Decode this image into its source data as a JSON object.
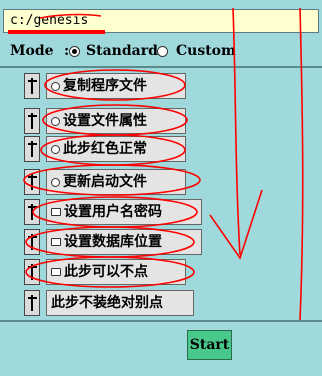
{
  "path": {
    "value": "c:/genesis"
  },
  "mode": {
    "label": "Mode",
    "colon": ":",
    "options": [
      {
        "label": "Standard",
        "selected": true
      },
      {
        "label": "Custom",
        "selected": false
      }
    ]
  },
  "tasks": [
    {
      "label": "复制程序文件",
      "status_icon": "circle-icon"
    },
    {
      "label": "设置文件属性",
      "status_icon": "circle-icon"
    },
    {
      "label": "此步红色正常",
      "status_icon": "circle-icon"
    },
    {
      "label": "更新启动文件",
      "status_icon": "circle-icon"
    },
    {
      "label": "设置用户名密码",
      "status_icon": "lock-icon"
    },
    {
      "label": "设置数据库位置",
      "status_icon": "lock-icon"
    },
    {
      "label": "此步可以不点",
      "status_icon": "lock-icon"
    },
    {
      "label": "此步不装绝对别点",
      "status_icon": ""
    }
  ],
  "actions": {
    "start_label": "Start"
  },
  "colors": {
    "background": "#9fd9dc",
    "annotation": "#ff0000",
    "start_button": "#48c88a"
  }
}
